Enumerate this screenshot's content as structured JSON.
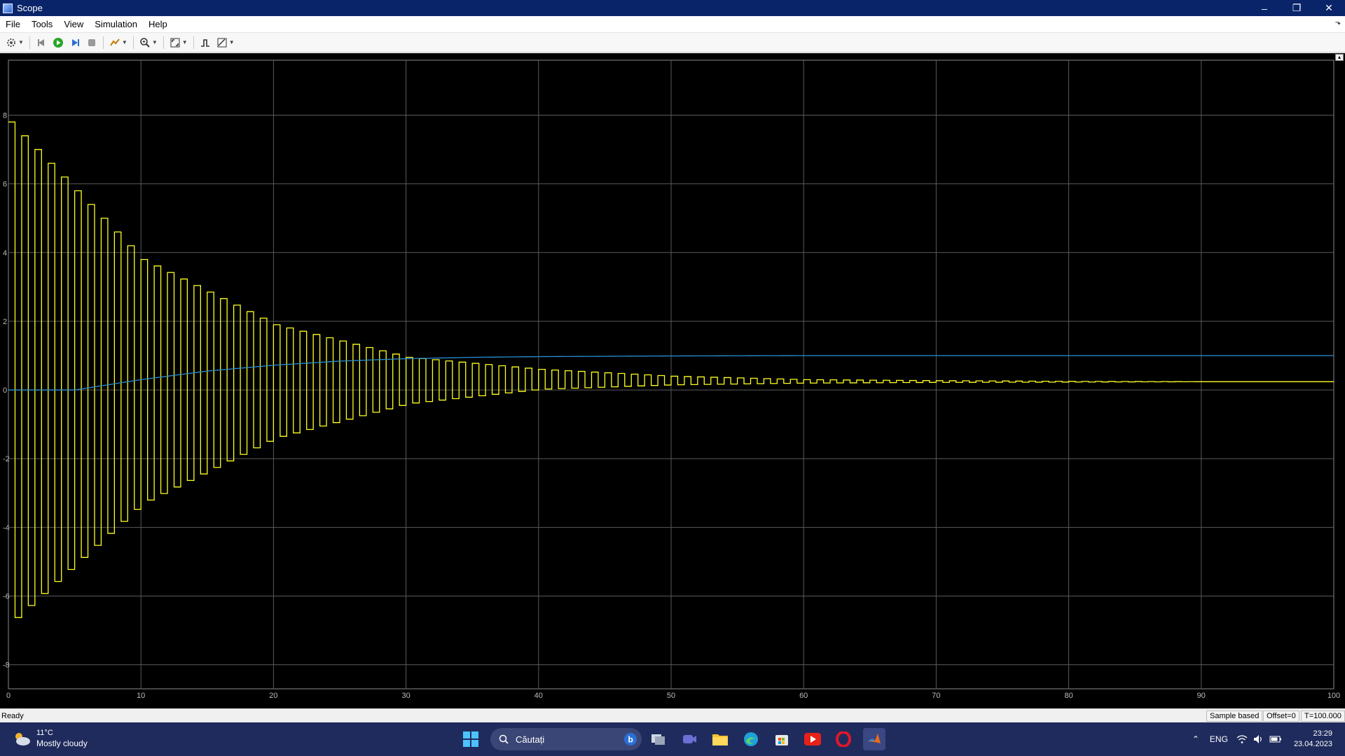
{
  "window": {
    "title": "Scope",
    "icon": "scope-app-icon"
  },
  "menu": [
    "File",
    "Tools",
    "View",
    "Simulation",
    "Help"
  ],
  "toolbar": {
    "buttons": [
      "settings-icon",
      "step-back-icon",
      "run-icon",
      "step-forward-icon",
      "stop-icon",
      "highlight-icon",
      "zoom-icon",
      "autoscale-icon",
      "triggers-icon",
      "measurements-icon"
    ]
  },
  "status": {
    "text": "Ready",
    "mode": "Sample based",
    "offset": "Offset=0",
    "time": "T=100.000"
  },
  "colors": {
    "series1": "#ffff22",
    "series2": "#2a8fd6",
    "grid": "#5a5a5a",
    "plot_bg": "#000000"
  },
  "chart_data": {
    "type": "line",
    "xlim": [
      0,
      100
    ],
    "ylim": [
      -8.7,
      9.6
    ],
    "xticks": [
      0,
      10,
      20,
      30,
      40,
      50,
      60,
      70,
      80,
      90,
      100
    ],
    "yticks": [
      8,
      6,
      4,
      2,
      0,
      -2,
      -4,
      -6,
      -8
    ],
    "xtick_labels": [
      "0",
      "10",
      "20",
      "30",
      "40",
      "50",
      "60",
      "70",
      "80",
      "90",
      "100"
    ],
    "ytick_labels": [
      "8",
      "6",
      "4",
      "2",
      "0",
      "-2",
      "-4",
      "-6",
      "-8"
    ],
    "grid": true,
    "series": [
      {
        "style": "zero-order-hold oscillation",
        "color": "#ffff22",
        "envelope_top": {
          "x": [
            0,
            10,
            20,
            30,
            40,
            50,
            60,
            70,
            80,
            90
          ],
          "y": [
            7.8,
            3.8,
            1.9,
            0.95,
            0.6,
            0.4,
            0.3,
            0.27,
            0.25,
            0.24
          ]
        },
        "envelope_bottom": {
          "x": [
            0,
            10,
            20,
            30,
            40,
            50,
            60,
            70,
            80,
            90
          ],
          "y": [
            -6.8,
            -3.3,
            -1.4,
            -0.4,
            0.02,
            0.15,
            0.2,
            0.22,
            0.23,
            0.24
          ]
        },
        "period": 1.0,
        "final_value": 0.24
      },
      {
        "color": "#2a8fd6",
        "x": [
          0,
          5,
          10,
          15,
          20,
          25,
          30,
          35,
          40,
          50,
          60,
          70,
          80,
          90,
          100
        ],
        "y": [
          0,
          0,
          0.3,
          0.55,
          0.72,
          0.84,
          0.91,
          0.95,
          0.97,
          0.99,
          1.0,
          1.0,
          1.0,
          1.0,
          1.0
        ]
      }
    ]
  },
  "taskbar": {
    "weather_temp": "11°C",
    "weather_desc": "Mostly cloudy",
    "search_placeholder": "Căutați",
    "apps": [
      "windows-start-icon",
      "bing-icon",
      "task-view-icon",
      "teams-icon",
      "file-explorer-icon",
      "edge-icon",
      "store-icon",
      "youtube-icon",
      "opera-icon",
      "matlab-icon"
    ],
    "language": "ENG",
    "time": "23:29",
    "date": "23.04.2023"
  }
}
